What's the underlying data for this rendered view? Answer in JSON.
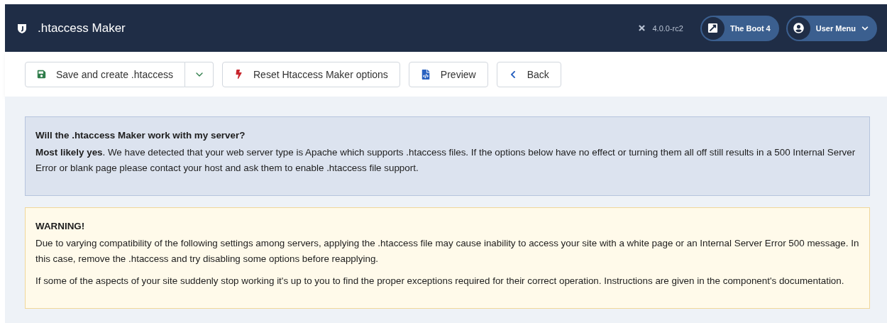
{
  "header": {
    "title": ".htaccess Maker",
    "version": "4.0.0-rc2",
    "buttons": [
      {
        "kind": "link",
        "label": "The Boot 4"
      },
      {
        "kind": "menu",
        "label": "User Menu"
      }
    ]
  },
  "toolbar": {
    "buttons": [
      {
        "kind": "save",
        "label": "Save and create .htaccess"
      },
      {
        "kind": "reset",
        "label": "Reset Htaccess Maker options"
      },
      {
        "kind": "preview",
        "label": "Preview"
      },
      {
        "kind": "back",
        "label": "Back"
      }
    ]
  },
  "alerts": [
    {
      "kind": "info",
      "heading": "Will the .htaccess Maker work with my server?",
      "paragraphs": [
        "**Most likely yes**. We have detected that your web server type is Apache which supports .htaccess files. If the options below have no effect or turning them all off still results in a 500 Internal Server Error or blank page please contact your host and ask them to enable .htaccess file support."
      ]
    },
    {
      "kind": "warning",
      "heading": "WARNING!",
      "paragraphs": [
        "Due to varying compatibility of the following settings among servers, applying the .htaccess file may cause inability to access your site with a white page or an Internal Server Error 500 message. In this case, remove the .htaccess and try disabling some options before reapplying.",
        "If some of the aspects of your site suddenly stop working it's up to you to find the proper exceptions required for their correct operation. Instructions are given in the component's documentation."
      ]
    }
  ]
}
